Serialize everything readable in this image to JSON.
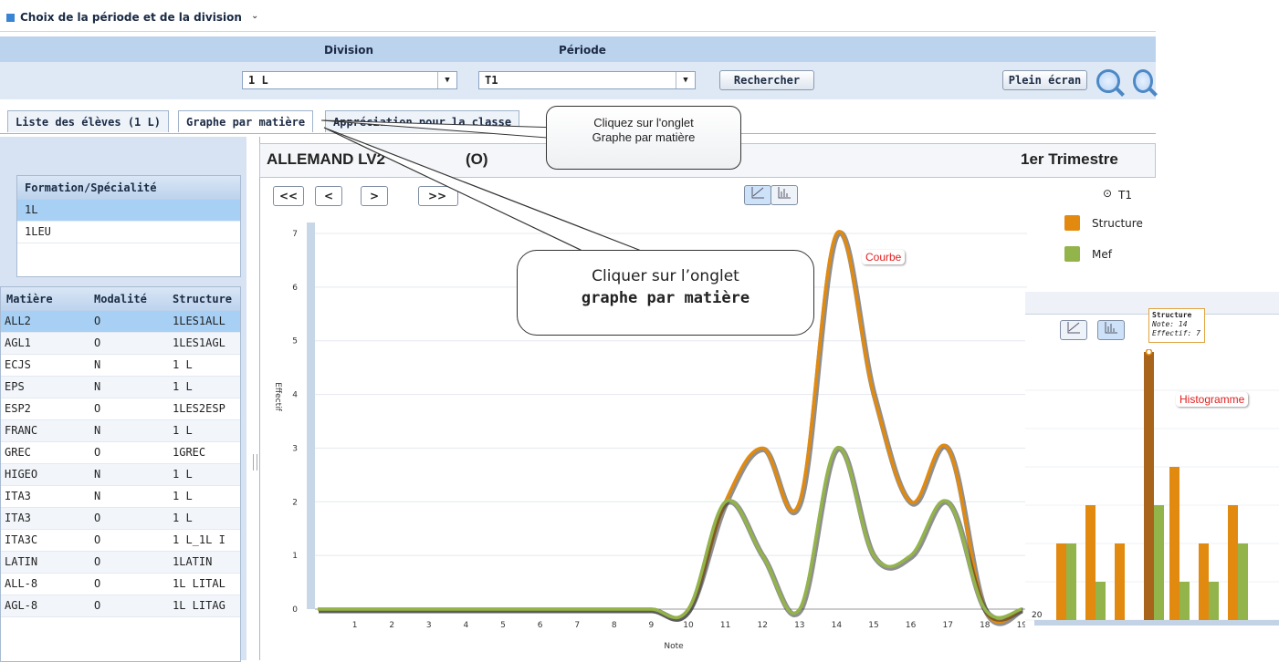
{
  "page_title": "Choix de la période et de la division",
  "filters": {
    "division_label": "Division",
    "periode_label": "Période",
    "division_value": "1 L",
    "periode_value": "T1",
    "search_button": "Rechercher",
    "fullscreen_button": "Plein écran"
  },
  "tabs": [
    "Liste des élèves (1 L)",
    "Graphe par matière",
    "Appréciation pour la classe"
  ],
  "formation": {
    "header": "Formation/Spécialité",
    "items": [
      "1L",
      "1LEU"
    ],
    "selected": "1L"
  },
  "subjects": {
    "headers": [
      "Matière",
      "Modalité",
      "Structure"
    ],
    "rows": [
      [
        "ALL2",
        "O",
        "1LES1ALL"
      ],
      [
        "AGL1",
        "O",
        "1LES1AGL"
      ],
      [
        "ECJS",
        "N",
        "1 L"
      ],
      [
        "EPS",
        "N",
        "1 L"
      ],
      [
        "ESP2",
        "O",
        "1LES2ESP"
      ],
      [
        "FRANC",
        "N",
        "1 L"
      ],
      [
        "GREC",
        "O",
        "1GREC"
      ],
      [
        "HIGEO",
        "N",
        "1 L"
      ],
      [
        "ITA3",
        "N",
        "1 L"
      ],
      [
        "ITA3",
        "O",
        "1 L"
      ],
      [
        "ITA3C",
        "O",
        "1 L_1L I"
      ],
      [
        "LATIN",
        "O",
        "1LATIN"
      ],
      [
        "ALL-8",
        "O",
        "1L LITAL"
      ],
      [
        "AGL-8",
        "O",
        "1L LITAG"
      ]
    ],
    "selected": "ALL2"
  },
  "chart_header": {
    "subject": "ALLEMAND LV2",
    "modality": "(O)",
    "period": "1er Trimestre",
    "nav_buttons": [
      "<<",
      "<",
      ">",
      ">>"
    ],
    "radio_label": "T1"
  },
  "callouts": {
    "small_line1": "Cliquez sur l'onglet",
    "small_line2": "Graphe par matière",
    "big_line1": "Cliquer sur l’onglet",
    "big_line2": "graphe par matière",
    "courbe": "Courbe",
    "histogramme": "Histogramme"
  },
  "tooltip": {
    "title": "Structure",
    "line1": "Note: 14",
    "line2": "Effectif: 7"
  },
  "colors": {
    "structure": "#e28a0f",
    "mef": "#93b44a",
    "structure_dark": "#a8641a",
    "accent": "#3a84d4"
  },
  "chart_data": {
    "type": "line",
    "xlabel": "Note",
    "ylabel": "Effectif",
    "ylim": [
      0,
      7
    ],
    "x": [
      0,
      1,
      2,
      3,
      4,
      5,
      6,
      7,
      8,
      9,
      10,
      11,
      12,
      13,
      14,
      15,
      16,
      17,
      18,
      19
    ],
    "x_tick_labels": [
      "1",
      "2",
      "3",
      "4",
      "5",
      "6",
      "7",
      "8",
      "9",
      "10",
      "11",
      "12",
      "13",
      "14",
      "15",
      "16",
      "17",
      "18",
      "19"
    ],
    "y_tick_labels": [
      "0",
      "1",
      "2",
      "3",
      "4",
      "5",
      "6",
      "7"
    ],
    "series": [
      {
        "name": "Structure",
        "values": [
          0,
          0,
          0,
          0,
          0,
          0,
          0,
          0,
          0,
          0,
          0,
          2,
          3,
          2,
          7,
          4,
          2,
          3,
          0,
          0
        ]
      },
      {
        "name": "Mef",
        "values": [
          0,
          0,
          0,
          0,
          0,
          0,
          0,
          0,
          0,
          0,
          0,
          2,
          1,
          0,
          3,
          1,
          1,
          2,
          0,
          0
        ]
      }
    ],
    "legend": "top-right"
  },
  "histogram_inset": {
    "type": "bar",
    "series": [
      {
        "name": "Structure",
        "values": [
          2,
          3,
          2,
          7,
          4,
          2,
          3
        ]
      },
      {
        "name": "Mef",
        "values": [
          2,
          1,
          0,
          3,
          1,
          1,
          2
        ]
      }
    ],
    "edge_tick_label": "20"
  }
}
